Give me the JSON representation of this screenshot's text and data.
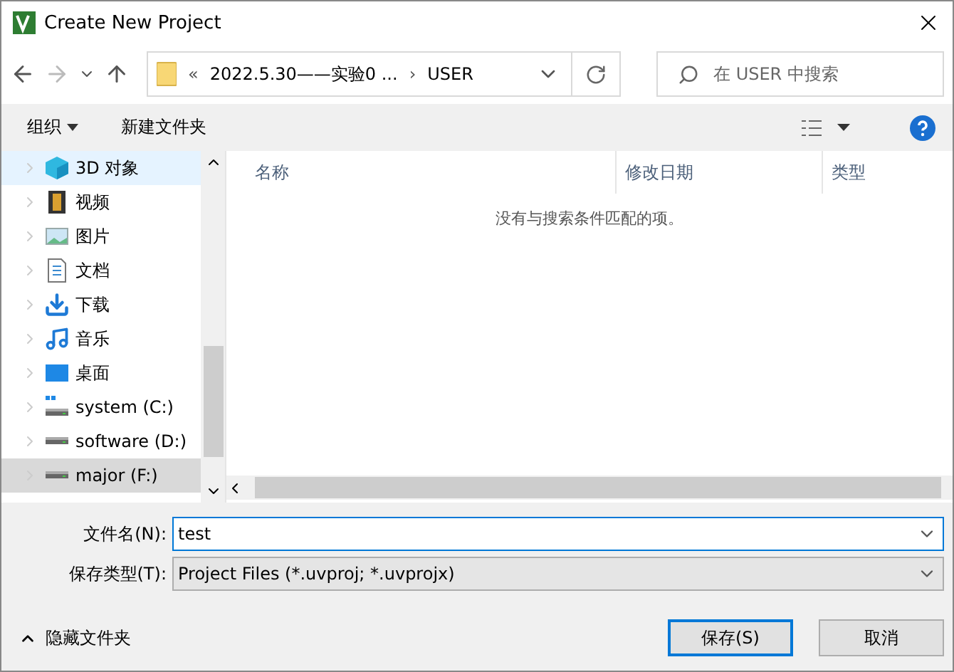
{
  "window": {
    "title": "Create New Project"
  },
  "address": {
    "overflow": "«",
    "path": "2022.5.30——实验0 ...",
    "separator": "›",
    "current": "USER"
  },
  "search": {
    "placeholder": "在 USER 中搜索"
  },
  "toolbar": {
    "organize": "组织",
    "new_folder": "新建文件夹"
  },
  "sidebar": {
    "items": [
      {
        "label": "3D 对象",
        "kind": "cube",
        "selected": true,
        "hovered": false
      },
      {
        "label": "视频",
        "kind": "film",
        "selected": false,
        "hovered": false
      },
      {
        "label": "图片",
        "kind": "image",
        "selected": false,
        "hovered": false
      },
      {
        "label": "文档",
        "kind": "document",
        "selected": false,
        "hovered": false
      },
      {
        "label": "下载",
        "kind": "download",
        "selected": false,
        "hovered": false
      },
      {
        "label": "音乐",
        "kind": "music",
        "selected": false,
        "hovered": false
      },
      {
        "label": "桌面",
        "kind": "desktop",
        "selected": false,
        "hovered": false
      },
      {
        "label": "system (C:)",
        "kind": "system-drive",
        "selected": false,
        "hovered": false
      },
      {
        "label": "software (D:)",
        "kind": "drive",
        "selected": false,
        "hovered": false
      },
      {
        "label": "major (F:)",
        "kind": "drive",
        "selected": false,
        "hovered": true
      }
    ]
  },
  "table": {
    "columns": [
      "名称",
      "修改日期",
      "类型"
    ],
    "empty_message": "没有与搜索条件匹配的项。"
  },
  "form": {
    "filename_label": "文件名(N):",
    "filename": "test",
    "type_label": "保存类型(T):",
    "type": "Project Files (*.uvproj; *.uvprojx)"
  },
  "footer": {
    "hide_folders": "隐藏文件夹",
    "buttons": [
      {
        "label": "保存(S)",
        "kind": "primary"
      },
      {
        "label": "取消",
        "kind": "secondary"
      }
    ]
  }
}
